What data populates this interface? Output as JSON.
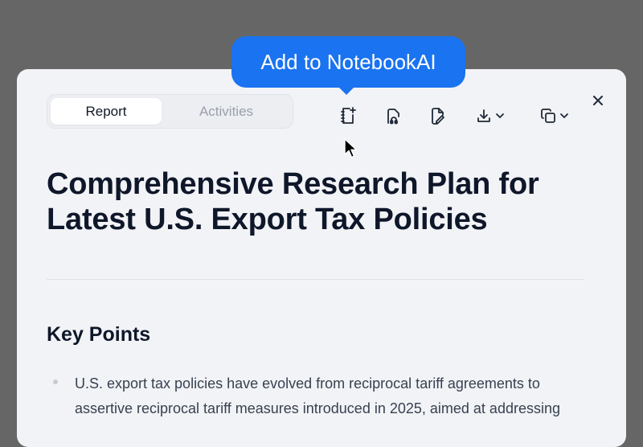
{
  "tooltip": {
    "text": "Add to NotebookAI"
  },
  "tabs": {
    "report": "Report",
    "activities": "Activities"
  },
  "toolbar": {
    "icons": [
      "add-to-notebook-icon",
      "headphones-icon",
      "edit-document-icon",
      "download-icon",
      "copy-icon"
    ]
  },
  "document": {
    "title": "Comprehensive Research Plan for Latest U.S. Export Tax Policies",
    "section_heading": "Key Points",
    "bullets": [
      "U.S. export tax policies have evolved from reciprocal tariff agreements to assertive reciprocal tariff measures introduced in 2025, aimed at addressing"
    ]
  },
  "colors": {
    "accent": "#1a73f0",
    "backdrop": "#666666",
    "panel": "#f2f3f6"
  }
}
